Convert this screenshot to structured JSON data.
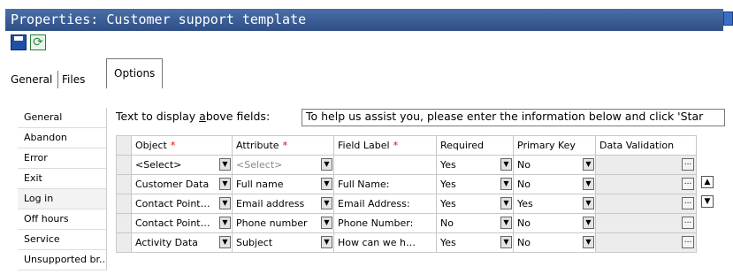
{
  "window": {
    "title": "Properties: Customer support template"
  },
  "toolbar": {
    "save_icon": "save-icon",
    "refresh_icon": "refresh-icon"
  },
  "tabs": [
    {
      "label": "General"
    },
    {
      "label": "Files"
    },
    {
      "label": "Options"
    }
  ],
  "sidebar": {
    "items": [
      {
        "label": "General"
      },
      {
        "label": "Abandon"
      },
      {
        "label": "Error"
      },
      {
        "label": "Exit"
      },
      {
        "label": "Log in"
      },
      {
        "label": "Off hours"
      },
      {
        "label": "Service"
      },
      {
        "label": "Unsupported br..."
      }
    ]
  },
  "display": {
    "label_prefix": "Text to display ",
    "label_access": "a",
    "label_suffix": "bove fields:",
    "value": "To help us assist you, please enter the information below and click 'Star"
  },
  "grid": {
    "columns": [
      "Object",
      "Attribute",
      "Field Label",
      "Required",
      "Primary Key",
      "Data Validation"
    ],
    "required_marker": "*",
    "rows": [
      {
        "object": "<Select>",
        "attribute": "<Select>",
        "field_label": "",
        "required": "Yes",
        "primary_key": "No"
      },
      {
        "object": "Customer Data",
        "attribute": "Full name",
        "field_label": "Full Name:",
        "required": "Yes",
        "primary_key": "No"
      },
      {
        "object": "Contact Point D...",
        "attribute": "Email address",
        "field_label": "Email Address:",
        "required": "Yes",
        "primary_key": "Yes"
      },
      {
        "object": "Contact Point D...",
        "attribute": "Phone number",
        "field_label": "Phone Number:",
        "required": "No",
        "primary_key": "No"
      },
      {
        "object": "Activity Data",
        "attribute": "Subject",
        "field_label": "How can we help y...",
        "required": "Yes",
        "primary_key": "No"
      }
    ]
  },
  "glyphs": {
    "dropdown": "▼",
    "ellipsis": "...",
    "up": "▲",
    "down": "▼"
  }
}
